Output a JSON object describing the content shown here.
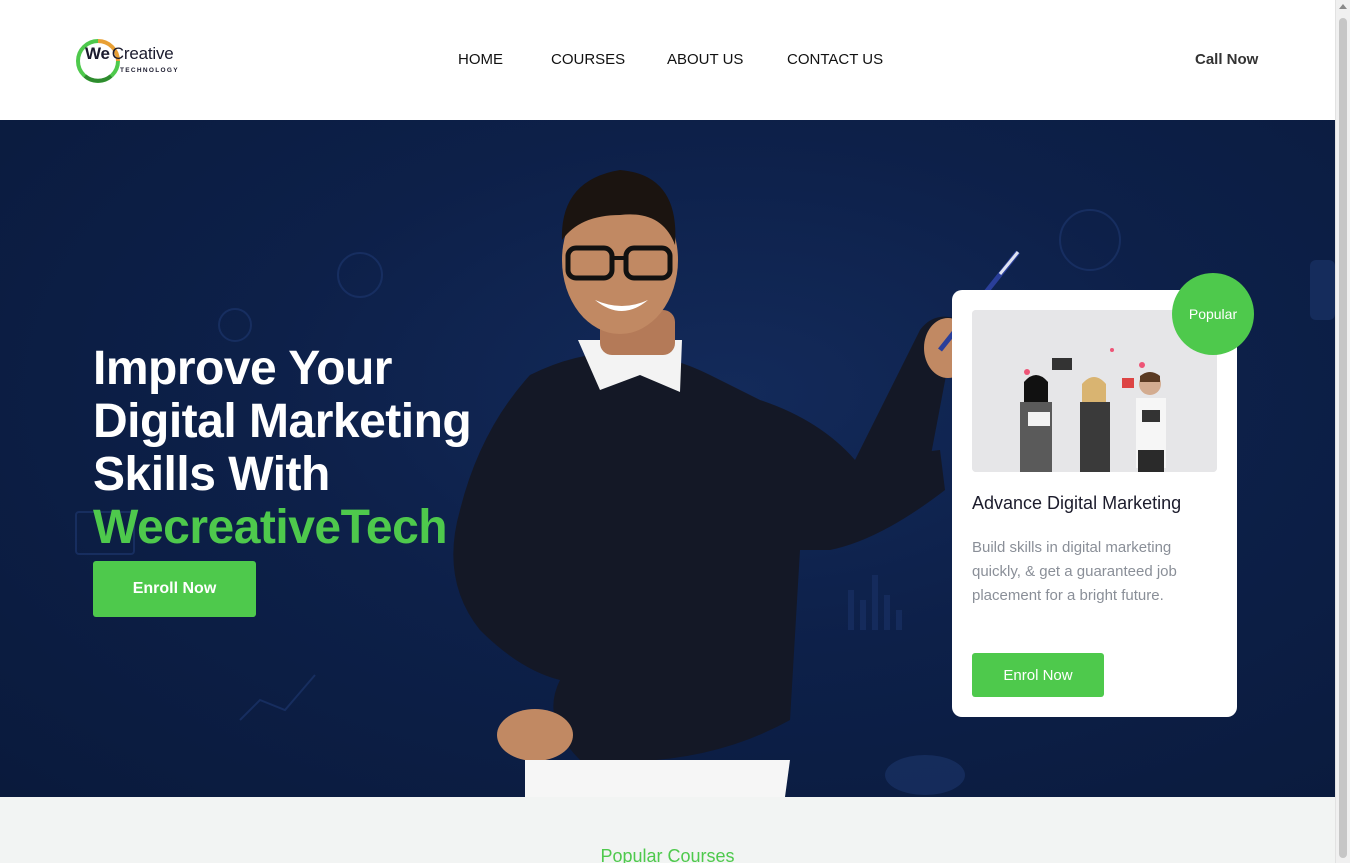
{
  "brand": {
    "logo_word_main": "We",
    "logo_word_second": "Creative",
    "logo_tagline": "TECHNOLOGY",
    "colors": {
      "accent": "#4ec94c",
      "hero_bg": "#0d2049",
      "logo_green": "#4ec94c",
      "logo_orange": "#e8a035"
    }
  },
  "nav": {
    "items": [
      {
        "label": "HOME"
      },
      {
        "label": "COURSES"
      },
      {
        "label": "ABOUT US"
      },
      {
        "label": "CONTACT US"
      }
    ],
    "cta_label": "Call Now"
  },
  "hero": {
    "title_lines": [
      "Improve Your",
      "Digital Marketing",
      "Skills With"
    ],
    "title_accent": "WecreativeTech",
    "button_label": "Enroll Now"
  },
  "course_card": {
    "badge": "Popular",
    "title": "Advance Digital Marketing",
    "description": "Build skills in digital marketing quickly, & get a guaranteed job placement for a bright future.",
    "button_label": "Enrol Now"
  },
  "section": {
    "heading": "Popular Courses"
  }
}
